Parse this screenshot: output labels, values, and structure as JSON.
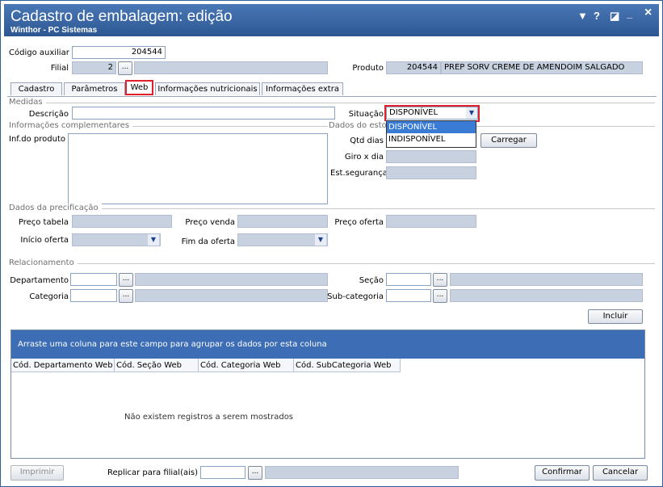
{
  "window": {
    "title": "Cadastro de embalagem: edição",
    "subtitle": "Winthor - PC Sistemas",
    "controls": {
      "menu": "▼",
      "help": "?",
      "restore": "◪",
      "minimize": "_",
      "close": "×"
    }
  },
  "header": {
    "codigo_label": "Código auxiliar",
    "codigo_value": "204544",
    "filial_label": "Filial",
    "filial_value": "2",
    "produto_label": "Produto",
    "produto_code": "204544",
    "produto_name": "PREP SORV CREME DE AMENDOIM SALGADO"
  },
  "tabs": [
    {
      "label": "Cadastro"
    },
    {
      "label": "Parâmetros"
    },
    {
      "label": "Web"
    },
    {
      "label": "Informações nutricionais"
    },
    {
      "label": "Informações extra"
    }
  ],
  "active_tab": "Web",
  "medidas": {
    "section": "Medidas",
    "descricao_label": "Descrição",
    "descricao_value": ""
  },
  "situacao": {
    "label": "Situação",
    "value": "DISPONÍVEL",
    "options": [
      "DISPONÍVEL",
      "INDISPONÍVEL"
    ]
  },
  "info_compl": {
    "section": "Informações complementares",
    "inf_label": "Inf.do produto"
  },
  "estoque": {
    "section": "Dados do estoque",
    "qtd_label": "Qtd dias",
    "giro_label": "Giro x dia",
    "seg_label": "Est.segurança",
    "carregar": "Carregar"
  },
  "precificacao": {
    "section": "Dados da precificação",
    "preco_tabela": "Preço tabela",
    "preco_venda": "Preço venda",
    "preco_oferta": "Preço oferta",
    "inicio_oferta": "Início oferta",
    "fim_oferta": "Fim da oferta"
  },
  "relacionamento": {
    "section": "Relacionamento",
    "departamento": "Departamento",
    "secao": "Seção",
    "categoria": "Categoria",
    "subcategoria": "Sub-categoria",
    "incluir": "Incluir"
  },
  "grid": {
    "group_hint": "Arraste uma coluna para este campo para agrupar os dados por esta coluna",
    "columns": [
      "Cód. Departamento Web",
      "Cód. Seção Web",
      "Cód. Categoria Web",
      "Cód. SubCategoria Web"
    ],
    "empty": "Não existem registros a serem mostrados"
  },
  "footer": {
    "imprimir": "Imprimir",
    "replicar_label": "Replicar para filial(ais)",
    "confirmar": "Confirmar",
    "cancelar": "Cancelar"
  },
  "icons": {
    "ellipsis": "...",
    "dropdown": "▼"
  },
  "colors": {
    "titlebar": "#2c5792",
    "highlight": "#e0202a",
    "readonly": "#c7d1df",
    "grid_header": "#3c6db5"
  }
}
